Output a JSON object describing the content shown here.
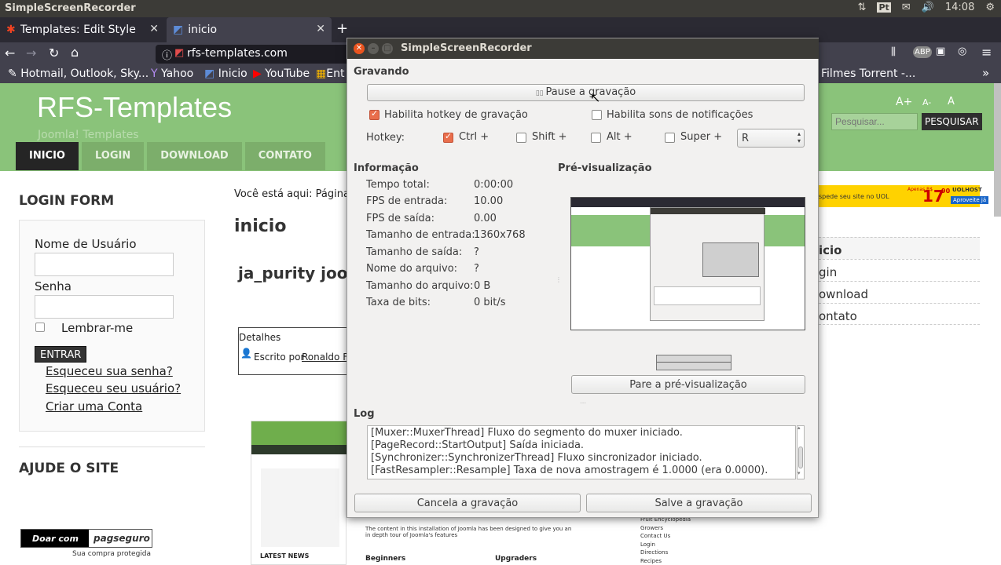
{
  "topbar": {
    "title": "SimpleScreenRecorder",
    "lang": "Pt",
    "time": "14:08"
  },
  "tabs": [
    {
      "label": "Templates: Edit Style - RF"
    },
    {
      "label": "inicio"
    }
  ],
  "nav": {
    "url": "rfs-templates.com"
  },
  "bookmarks": [
    "Hotmail, Outlook, Sky...",
    "Yahoo",
    "Inicio",
    "YouTube",
    "Ent",
    "Filmes Torrent -..."
  ],
  "site": {
    "logo": "RFS-Templates",
    "tagline": "Joomla! Templates",
    "menu": [
      "INICIO",
      "LOGIN",
      "DOWNLOAD",
      "CONTATO"
    ],
    "search_placeholder": "Pesquisar...",
    "search_button": "PESQUISAR",
    "font_controls": [
      "A+",
      "A-",
      "A"
    ],
    "login_form_title": "LOGIN FORM",
    "username_label": "Nome de Usuário",
    "password_label": "Senha",
    "remember_label": "Lembrar-me",
    "submit_label": "ENTRAR",
    "links": [
      "Esqueceu sua senha?",
      "Esqueceu seu usuário?",
      "Criar uma Conta"
    ],
    "help_title": "AJUDE O SITE",
    "donate_label": "Doar com",
    "pagseguro": "pagseguro",
    "pagseguro_sub": "Sua compra protegida",
    "breadcrumb": "Você está aqui: Página I",
    "page_heading": "inicio",
    "article_title": "ja_purity joon",
    "details_label": "Detalhes",
    "author_prefix": "Escrito por",
    "author_name": "Ronaldo Fa",
    "right_menu": [
      "icio",
      "gin",
      "ownload",
      "ontato"
    ],
    "ad_text": "spede seu site no UOL",
    "ad_price": "17",
    "ad_cents": "90",
    "ad_brand": "UOLHOST",
    "ad_button": "Aproveite já",
    "ad_small": "Apenas R$",
    "bottom_words": [
      "Beginners",
      "Upgraders",
      "LATEST NEWS",
      "The content in this installation of Joomla has been designed to give you an in depth tour of Joomla's features"
    ],
    "bottom_right_list": [
      "Fruit Encyclopedia",
      "Growers",
      "Contact Us",
      "Login",
      "Directions",
      "Recipes"
    ]
  },
  "dialog": {
    "title": "SimpleScreenRecorder",
    "section_recording": "Gravando",
    "pause_button": "Pause a gravação",
    "hotkey_enable": "Habilita hotkey de gravação",
    "sound_enable": "Habilita sons de notificações",
    "hotkey_label": "Hotkey:",
    "mods": [
      "Ctrl +",
      "Shift +",
      "Alt +",
      "Super +"
    ],
    "key_value": "R",
    "section_info": "Informação",
    "section_preview": "Pré-visualização",
    "info": [
      {
        "k": "Tempo total:",
        "v": "0:00:00"
      },
      {
        "k": "FPS de entrada:",
        "v": "10.00"
      },
      {
        "k": "FPS de saída:",
        "v": "0.00"
      },
      {
        "k": "Tamanho de entrada:",
        "v": "1360x768"
      },
      {
        "k": "Tamanho de saída:",
        "v": "?"
      },
      {
        "k": "Nome do arquivo:",
        "v": "?"
      },
      {
        "k": "Tamanho do arquivo:",
        "v": "0 B"
      },
      {
        "k": "Taxa de bits:",
        "v": "0 bit/s"
      }
    ],
    "preview_stop": "Pare a pré-visualização",
    "section_log": "Log",
    "log": [
      "[Muxer::MuxerThread] Fluxo do segmento do muxer iniciado.",
      "[PageRecord::StartOutput] Saída iniciada.",
      "[Synchronizer::SynchronizerThread] Fluxo sincronizador iniciado.",
      "[FastResampler::Resample] Taxa de nova amostragem é 1.0000 (era 0.0000)."
    ],
    "cancel_button": "Cancela a gravação",
    "save_button": "Salve a gravação"
  }
}
